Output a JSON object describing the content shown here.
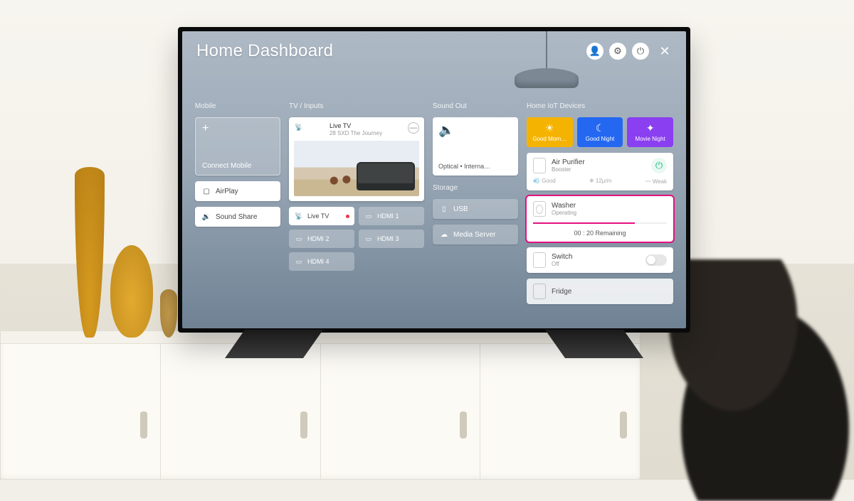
{
  "header": {
    "title": "Home Dashboard"
  },
  "columns": {
    "mobile": {
      "label": "Mobile",
      "connect": "Connect Mobile",
      "airplay": "AirPlay",
      "soundshare": "Sound Share"
    },
    "tv": {
      "label": "TV / Inputs",
      "live": {
        "title": "Live TV",
        "channel": "28 SXD",
        "program": "The Journey"
      },
      "inputs": {
        "live": "Live TV",
        "hdmi1": "HDMI 1",
        "hdmi2": "HDMI 2",
        "hdmi3": "HDMI 3",
        "hdmi4": "HDMI 4"
      }
    },
    "sound": {
      "label": "Sound Out",
      "value": "Optical • Interna…"
    },
    "storage": {
      "label": "Storage",
      "usb": "USB",
      "media": "Media Server"
    },
    "iot": {
      "label": "Home IoT Devices",
      "scenes": {
        "morning": "Good Morn…",
        "night": "Good Night",
        "movie": "Movie Night"
      },
      "airpurifier": {
        "name": "Air Purifier",
        "status": "Booster",
        "stat1": "Good",
        "stat2": "12μ/m",
        "stat3": "Weak"
      },
      "washer": {
        "name": "Washer",
        "status": "Operating",
        "remaining": "00 : 20 Remaining"
      },
      "switch": {
        "name": "Switch",
        "status": "Off"
      },
      "fridge": {
        "name": "Fridge"
      }
    }
  }
}
